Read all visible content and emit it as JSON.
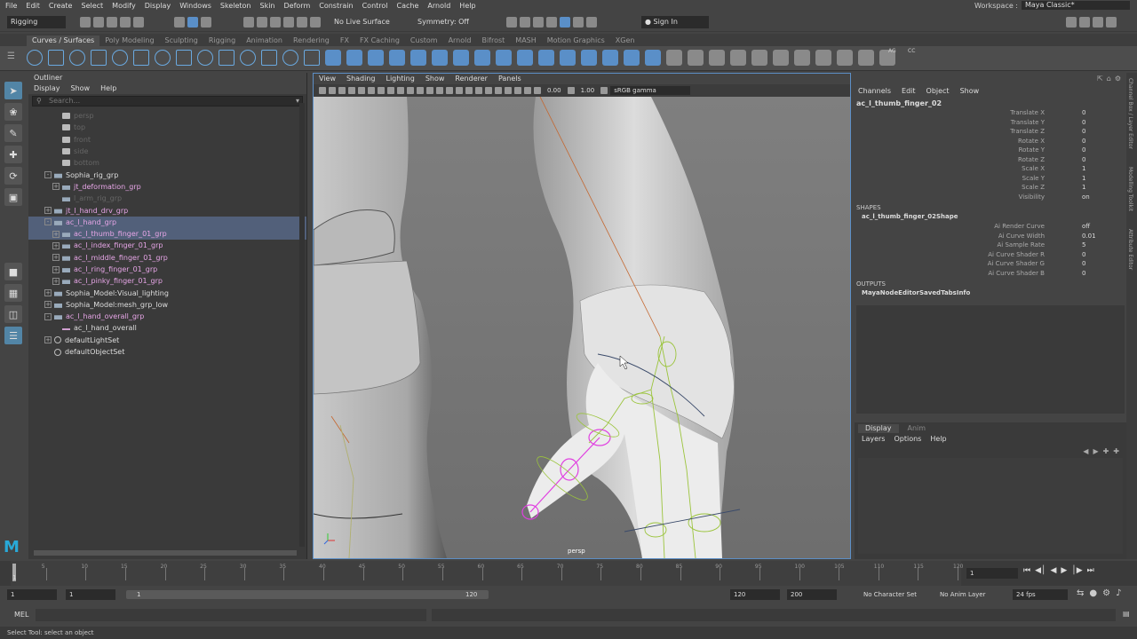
{
  "menubar": {
    "items": [
      "File",
      "Edit",
      "Create",
      "Select",
      "Modify",
      "Display",
      "Windows",
      "Skeleton",
      "Skin",
      "Deform",
      "Constrain",
      "Control",
      "Cache",
      "Arnold",
      "Help"
    ],
    "workspace_label": "Workspace :",
    "workspace_value": "Maya Classic*"
  },
  "statusline": {
    "mode": "Rigging",
    "live_surface": "No Live Surface",
    "symmetry": "Symmetry: Off",
    "sign_in": "Sign In"
  },
  "shelf": {
    "tabs": [
      "Curves / Surfaces",
      "Poly Modeling",
      "Sculpting",
      "Rigging",
      "Animation",
      "Rendering",
      "FX",
      "FX Caching",
      "Custom",
      "Arnold",
      "Bifrost",
      "MASH",
      "Motion Graphics",
      "XGen"
    ],
    "active_tab": "Curves / Surfaces",
    "badge_ag": "AG",
    "badge_cc": "CC"
  },
  "outliner": {
    "title": "Outliner",
    "menu": [
      "Display",
      "Show",
      "Help"
    ],
    "search_placeholder": "Search...",
    "rows": [
      {
        "label": "persp",
        "type": "cam",
        "indent": 1,
        "dim": true
      },
      {
        "label": "top",
        "type": "cam",
        "indent": 1,
        "dim": true
      },
      {
        "label": "front",
        "type": "cam",
        "indent": 1,
        "dim": true
      },
      {
        "label": "side",
        "type": "cam",
        "indent": 1,
        "dim": true
      },
      {
        "label": "bottom",
        "type": "cam",
        "indent": 1,
        "dim": true
      },
      {
        "label": "Sophia_rig_grp",
        "type": "grp",
        "indent": 0,
        "exp": "-"
      },
      {
        "label": "jt_deformation_grp",
        "type": "grp",
        "indent": 1,
        "exp": "+"
      },
      {
        "label": "l_arm_rig_grp",
        "type": "grp",
        "indent": 1,
        "dim": true
      },
      {
        "label": "jt_l_hand_drv_grp",
        "type": "grp",
        "indent": 0,
        "exp": "+"
      },
      {
        "label": "ac_l_hand_grp",
        "type": "grp",
        "indent": 0,
        "exp": "-",
        "sel": true
      },
      {
        "label": "ac_l_thumb_finger_01_grp",
        "type": "grp",
        "indent": 1,
        "exp": "+",
        "sel": true
      },
      {
        "label": "ac_l_index_finger_01_grp",
        "type": "grp",
        "indent": 1,
        "exp": "+"
      },
      {
        "label": "ac_l_middle_finger_01_grp",
        "type": "grp",
        "indent": 1,
        "exp": "+"
      },
      {
        "label": "ac_l_ring_finger_01_grp",
        "type": "grp",
        "indent": 1,
        "exp": "+"
      },
      {
        "label": "ac_l_pinky_finger_01_grp",
        "type": "grp",
        "indent": 1,
        "exp": "+"
      },
      {
        "label": "Sophia_Model:Visual_lighting",
        "type": "grp",
        "indent": 0,
        "exp": "+"
      },
      {
        "label": "Sophia_Model:mesh_grp_low",
        "type": "grp",
        "indent": 0,
        "exp": "+"
      },
      {
        "label": "ac_l_hand_overall_grp",
        "type": "grp",
        "indent": 0,
        "exp": "-"
      },
      {
        "label": "ac_l_hand_overall",
        "type": "crv",
        "indent": 1
      },
      {
        "label": "defaultLightSet",
        "type": "set",
        "indent": 0,
        "exp": "+"
      },
      {
        "label": "defaultObjectSet",
        "type": "set",
        "indent": 0
      }
    ]
  },
  "viewport": {
    "menu": [
      "View",
      "Shading",
      "Lighting",
      "Show",
      "Renderer",
      "Panels"
    ],
    "exposure": "0.00",
    "gamma_value": "1.00",
    "color_space": "sRGB gamma",
    "camera": "persp"
  },
  "channelbox": {
    "menu": [
      "Channels",
      "Edit",
      "Object",
      "Show"
    ],
    "node": "ac_l_thumb_finger_02",
    "attrs": [
      {
        "name": "Translate X",
        "value": "0"
      },
      {
        "name": "Translate Y",
        "value": "0"
      },
      {
        "name": "Translate Z",
        "value": "0"
      },
      {
        "name": "Rotate X",
        "value": "0"
      },
      {
        "name": "Rotate Y",
        "value": "0"
      },
      {
        "name": "Rotate Z",
        "value": "0"
      },
      {
        "name": "Scale X",
        "value": "1"
      },
      {
        "name": "Scale Y",
        "value": "1"
      },
      {
        "name": "Scale Z",
        "value": "1"
      },
      {
        "name": "Visibility",
        "value": "on"
      }
    ],
    "shapes_label": "SHAPES",
    "shape_node": "ac_l_thumb_finger_02Shape",
    "shape_attrs": [
      {
        "name": "Ai Render Curve",
        "value": "off"
      },
      {
        "name": "Ai Curve Width",
        "value": "0.01"
      },
      {
        "name": "Ai Sample Rate",
        "value": "5"
      },
      {
        "name": "Ai Curve Shader R",
        "value": "0"
      },
      {
        "name": "Ai Curve Shader G",
        "value": "0"
      },
      {
        "name": "Ai Curve Shader B",
        "value": "0"
      }
    ],
    "outputs_label": "OUTPUTS",
    "output_node": "MayaNodeEditorSavedTabsInfo"
  },
  "layers": {
    "tabs": [
      "Display",
      "Anim"
    ],
    "menu": [
      "Layers",
      "Options",
      "Help"
    ]
  },
  "sidetabs": [
    "Channel Box / Layer Editor",
    "Modelling Toolkit",
    "Attribute Editor"
  ],
  "timeline": {
    "ticks": [
      "5",
      "10",
      "15",
      "20",
      "25",
      "30",
      "35",
      "40",
      "45",
      "50",
      "55",
      "60",
      "65",
      "70",
      "75",
      "80",
      "85",
      "90",
      "95",
      "100",
      "105",
      "110",
      "115",
      "120"
    ],
    "current_frame": "1",
    "start_label": "1"
  },
  "range": {
    "start": "1",
    "playback_start": "1",
    "slider_start": "1",
    "slider_end": "120",
    "playback_end": "120",
    "end": "200",
    "character_set": "No Character Set",
    "anim_layer": "No Anim Layer",
    "fps": "24 fps"
  },
  "cmd": {
    "lang": "MEL"
  },
  "help_line": "Select Tool: select an object"
}
